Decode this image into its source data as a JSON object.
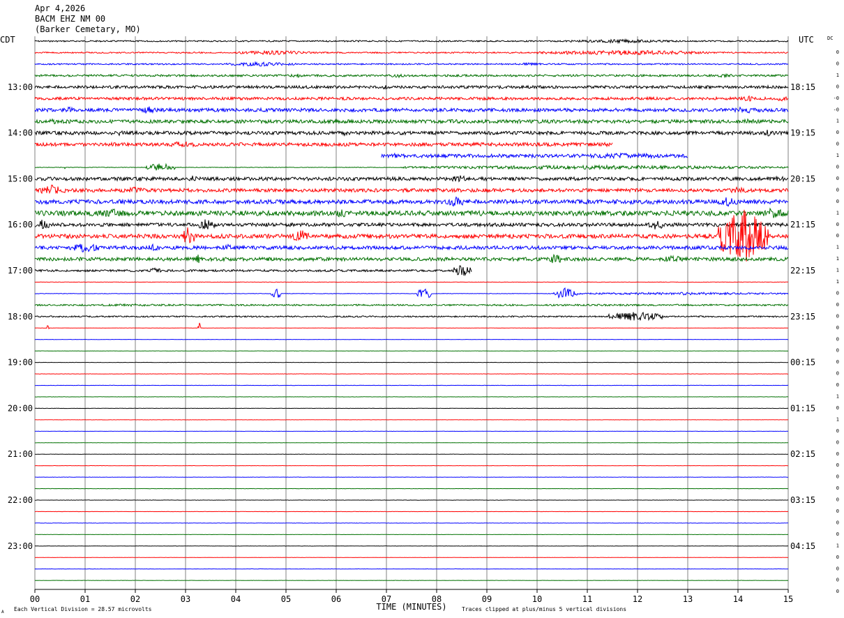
{
  "header": {
    "date": "Apr 4,2026",
    "station": "BACM EHZ NM 00",
    "location": "(Barker Cemetary, MO)"
  },
  "corner_labels": {
    "left": "CDT",
    "right": "UTC",
    "far_right": "DC"
  },
  "footer": {
    "scale_note": "Each Vertical Division =   28.57 microvolts",
    "clip_note": "Traces clipped at plus/minus 5 vertical divisions",
    "mark": "A"
  },
  "chart_data": {
    "type": "line",
    "title": "",
    "xlabel": "TIME (MINUTES)",
    "ylabel": "",
    "xlim": [
      0,
      15
    ],
    "x_tick_labels": [
      "00",
      "01",
      "02",
      "03",
      "04",
      "05",
      "06",
      "07",
      "08",
      "09",
      "10",
      "11",
      "12",
      "13",
      "14",
      "15"
    ],
    "left_time_labels": [
      "13:00",
      "14:00",
      "15:00",
      "16:00",
      "17:00",
      "18:00",
      "19:00",
      "20:00",
      "21:00",
      "22:00",
      "23:00"
    ],
    "right_time_labels": [
      "18:15",
      "19:15",
      "20:15",
      "21:15",
      "22:15",
      "23:15",
      "00:15",
      "01:15",
      "02:15",
      "03:15",
      "04:15"
    ],
    "trace_count": 48,
    "traces_per_hour": 4,
    "first_labeled_trace": 4,
    "trace_colors": [
      "#000000",
      "#ff0000",
      "#0000ff",
      "#007000"
    ],
    "dc_offsets": [
      "0",
      "0",
      "1",
      "0",
      "-0",
      "-0",
      "1",
      "0",
      "0",
      "1",
      "0",
      "0",
      "0",
      "0",
      "1",
      "0",
      "0",
      "1",
      "1",
      "1",
      "1",
      "0",
      "0",
      "0",
      "0",
      "0",
      "0",
      "0",
      "0",
      "0",
      "1",
      "0",
      "1",
      "0",
      "0",
      "0",
      "0",
      "0",
      "0",
      "0",
      "0",
      "0",
      "0",
      "1",
      "0",
      "0",
      "0",
      "0"
    ],
    "traces": [
      {
        "index": 0,
        "baseline": 1,
        "bursts": [
          {
            "t0": 10.5,
            "t1": 12.8,
            "amp": 2.5
          }
        ]
      },
      {
        "index": 1,
        "baseline": 1,
        "bursts": [
          {
            "t0": 4,
            "t1": 5.5,
            "amp": 3
          },
          {
            "t0": 10,
            "t1": 13.5,
            "amp": 3.5
          }
        ]
      },
      {
        "index": 2,
        "baseline": 1,
        "bursts": [
          {
            "t0": 3.8,
            "t1": 5.2,
            "amp": 3
          },
          {
            "t0": 9.5,
            "t1": 10.2,
            "amp": 2
          }
        ]
      },
      {
        "index": 3,
        "baseline": 1.5,
        "bursts": [
          {
            "t0": 5,
            "t1": 5.4,
            "amp": 3
          },
          {
            "t0": 7,
            "t1": 7.5,
            "amp": 3
          },
          {
            "t0": 13.5,
            "t1": 14,
            "amp": 3
          }
        ]
      },
      {
        "index": 4,
        "baseline": 2,
        "bursts": [
          {
            "t0": 1.8,
            "t1": 2,
            "amp": 3
          },
          {
            "t0": 6.9,
            "t1": 7.1,
            "amp": 4
          },
          {
            "t0": 9.2,
            "t1": 9.4,
            "amp": 3
          }
        ]
      },
      {
        "index": 5,
        "baseline": 2,
        "bursts": [
          {
            "t0": 14.1,
            "t1": 14.3,
            "amp": 5
          },
          {
            "t0": 14.7,
            "t1": 15,
            "amp": 4
          }
        ]
      },
      {
        "index": 6,
        "baseline": 2.5,
        "bursts": [
          {
            "t0": 0.6,
            "t1": 0.8,
            "amp": 5
          },
          {
            "t0": 2.1,
            "t1": 2.4,
            "amp": 6
          },
          {
            "t0": 13.8,
            "t1": 14.6,
            "amp": 5
          }
        ]
      },
      {
        "index": 7,
        "baseline": 2.5,
        "bursts": [
          {
            "t0": 0.2,
            "t1": 0.5,
            "amp": 4
          },
          {
            "t0": 8.2,
            "t1": 8.5,
            "amp": 4
          },
          {
            "t0": 14,
            "t1": 14.5,
            "amp": 4
          }
        ]
      },
      {
        "index": 8,
        "baseline": 2.5,
        "bursts": [
          {
            "t0": 1.6,
            "t1": 1.8,
            "amp": 4
          },
          {
            "t0": 6,
            "t1": 6.3,
            "amp": 4
          },
          {
            "t0": 14.5,
            "t1": 14.7,
            "amp": 5
          }
        ]
      },
      {
        "index": 9,
        "baseline": 2.5,
        "t_end": 11.5,
        "bursts": [
          {
            "t0": 2.4,
            "t1": 3.4,
            "amp": 4
          },
          {
            "t0": 11.2,
            "t1": 11.5,
            "amp": 4
          }
        ]
      },
      {
        "index": 10,
        "baseline": 2.5,
        "t_start": 6.9,
        "t_end": 13,
        "bursts": [
          {
            "t0": 7,
            "t1": 7.4,
            "amp": 4
          },
          {
            "t0": 10.6,
            "t1": 13,
            "amp": 4
          },
          {
            "t0": 13.9,
            "t1": 14.1,
            "amp": 5
          }
        ]
      },
      {
        "index": 11,
        "baseline": 0.4,
        "bursts": [
          {
            "t0": 0.55,
            "t1": 0.6,
            "amp": 4
          },
          {
            "t0": 2.2,
            "t1": 2.8,
            "amp": 6
          },
          {
            "t0": 7.3,
            "t1": 15,
            "amp": 3
          }
        ]
      },
      {
        "index": 12,
        "baseline": 2.5,
        "bursts": [
          {
            "t0": 3,
            "t1": 3.3,
            "amp": 5
          },
          {
            "t0": 8.3,
            "t1": 8.6,
            "amp": 6
          },
          {
            "t0": 14.7,
            "t1": 15,
            "amp": 5
          }
        ]
      },
      {
        "index": 13,
        "baseline": 2.5,
        "bursts": [
          {
            "t0": 0.1,
            "t1": 0.6,
            "amp": 8
          },
          {
            "t0": 1.8,
            "t1": 2.2,
            "amp": 5
          },
          {
            "t0": 13.8,
            "t1": 14.2,
            "amp": 5
          }
        ]
      },
      {
        "index": 14,
        "baseline": 3,
        "bursts": [
          {
            "t0": 8.2,
            "t1": 8.6,
            "amp": 8
          },
          {
            "t0": 13.6,
            "t1": 14,
            "amp": 7
          }
        ]
      },
      {
        "index": 15,
        "baseline": 3.5,
        "bursts": [
          {
            "t0": 1.1,
            "t1": 1.8,
            "amp": 8
          },
          {
            "t0": 6,
            "t1": 6.2,
            "amp": 8
          },
          {
            "t0": 14.5,
            "t1": 15,
            "amp": 9
          }
        ]
      },
      {
        "index": 16,
        "baseline": 2.5,
        "bursts": [
          {
            "t0": 0,
            "t1": 0.3,
            "amp": 8
          },
          {
            "t0": 3.2,
            "t1": 3.6,
            "amp": 8
          },
          {
            "t0": 12.2,
            "t1": 12.5,
            "amp": 9
          }
        ]
      },
      {
        "index": 17,
        "baseline": 3,
        "bursts": [
          {
            "t0": 2.9,
            "t1": 3.2,
            "amp": 14
          },
          {
            "t0": 5.1,
            "t1": 5.5,
            "amp": 9
          },
          {
            "t0": 13.6,
            "t1": 14.6,
            "amp": 40
          }
        ]
      },
      {
        "index": 18,
        "baseline": 2.5,
        "bursts": [
          {
            "t0": 0.7,
            "t1": 1.3,
            "amp": 7
          },
          {
            "t0": 2.2,
            "t1": 2.5,
            "amp": 6
          },
          {
            "t0": 3.7,
            "t1": 4,
            "amp": 5
          }
        ]
      },
      {
        "index": 19,
        "baseline": 2.5,
        "bursts": [
          {
            "t0": 3.2,
            "t1": 3.3,
            "amp": 8
          },
          {
            "t0": 10.2,
            "t1": 10.5,
            "amp": 8
          },
          {
            "t0": 12.5,
            "t1": 12.9,
            "amp": 6
          }
        ]
      },
      {
        "index": 20,
        "baseline": 1.5,
        "t_end": 8.7,
        "bursts": [
          {
            "t0": 2.3,
            "t1": 2.5,
            "amp": 6
          },
          {
            "t0": 8.3,
            "t1": 8.7,
            "amp": 8
          }
        ]
      },
      {
        "index": 21,
        "baseline": 0.3,
        "bursts": []
      },
      {
        "index": 22,
        "baseline": 0.3,
        "bursts": [
          {
            "t0": 4.7,
            "t1": 4.9,
            "amp": 8
          },
          {
            "t0": 7.6,
            "t1": 7.9,
            "amp": 9
          },
          {
            "t0": 10.3,
            "t1": 10.8,
            "amp": 8
          },
          {
            "t0": 10.8,
            "t1": 15,
            "amp": 2
          }
        ]
      },
      {
        "index": 23,
        "baseline": 1.2,
        "bursts": [
          {
            "t0": 1,
            "t1": 3,
            "amp": 2
          }
        ]
      },
      {
        "index": 24,
        "baseline": 1,
        "bursts": [
          {
            "t0": 11.4,
            "t1": 12.5,
            "amp": 7
          }
        ]
      },
      {
        "index": 25,
        "baseline": 0.2,
        "bursts": [
          {
            "t0": 0.25,
            "t1": 0.28,
            "amp": 8
          },
          {
            "t0": 3.25,
            "t1": 3.3,
            "amp": 9
          }
        ]
      },
      {
        "index": 26,
        "baseline": 0.2,
        "bursts": []
      },
      {
        "index": 27,
        "baseline": 0.2,
        "bursts": []
      },
      {
        "index": 28,
        "baseline": 0.2,
        "bursts": []
      },
      {
        "index": 29,
        "baseline": 0.2,
        "bursts": []
      },
      {
        "index": 30,
        "baseline": 0.2,
        "bursts": []
      },
      {
        "index": 31,
        "baseline": 0.2,
        "bursts": []
      },
      {
        "index": 32,
        "baseline": 0.2,
        "bursts": []
      },
      {
        "index": 33,
        "baseline": 0.2,
        "bursts": []
      },
      {
        "index": 34,
        "baseline": 0.2,
        "bursts": []
      },
      {
        "index": 35,
        "baseline": 0.2,
        "bursts": []
      },
      {
        "index": 36,
        "baseline": 0.2,
        "bursts": []
      },
      {
        "index": 37,
        "baseline": 0.2,
        "bursts": []
      },
      {
        "index": 38,
        "baseline": 0.2,
        "bursts": []
      },
      {
        "index": 39,
        "baseline": 0.2,
        "bursts": []
      },
      {
        "index": 40,
        "baseline": 0.2,
        "bursts": []
      },
      {
        "index": 41,
        "baseline": 0.2,
        "bursts": []
      },
      {
        "index": 42,
        "baseline": 0.2,
        "bursts": []
      },
      {
        "index": 43,
        "baseline": 0.2,
        "bursts": []
      },
      {
        "index": 44,
        "baseline": 0.2,
        "bursts": []
      },
      {
        "index": 45,
        "baseline": 0.2,
        "bursts": []
      },
      {
        "index": 46,
        "baseline": 0.2,
        "bursts": []
      },
      {
        "index": 47,
        "baseline": 0.2,
        "bursts": []
      }
    ]
  }
}
